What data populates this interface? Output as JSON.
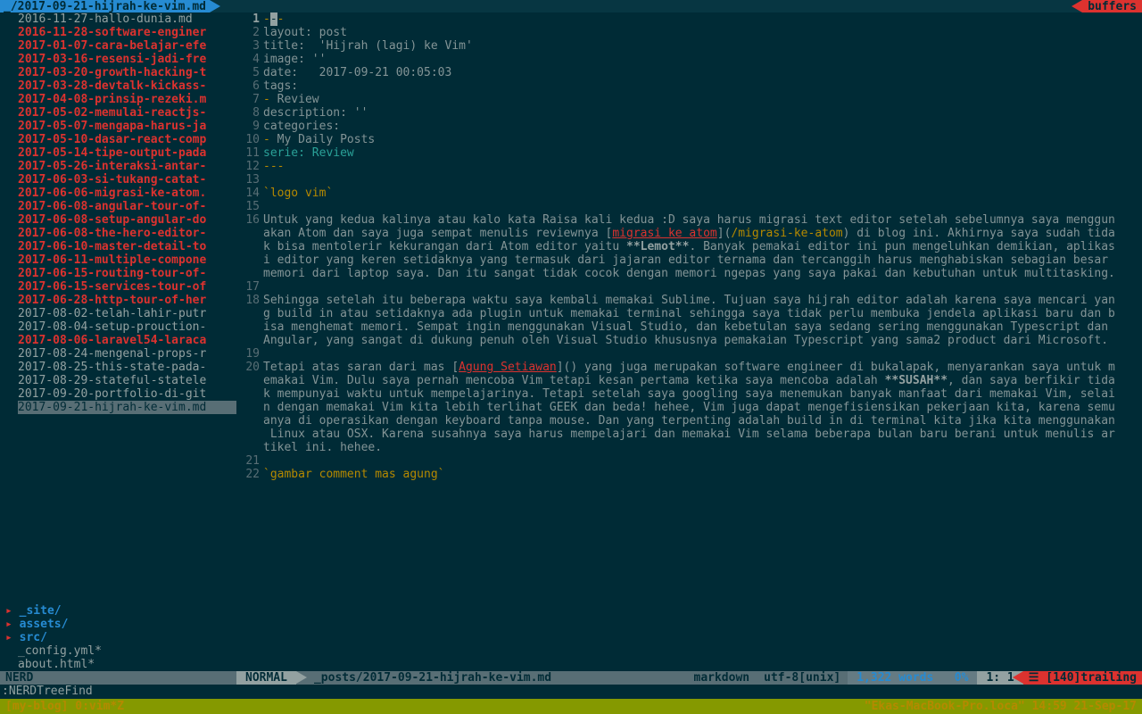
{
  "titlebar": {
    "current": "_/2017-09-21-hijrah-ke-vim.md",
    "right": "buffers"
  },
  "files": [
    {
      "name": "2016-11-27-hallo-dunia.md",
      "mod": false
    },
    {
      "name": "2016-11-28-software-enginer",
      "mod": true
    },
    {
      "name": "2017-01-07-cara-belajar-efe",
      "mod": true
    },
    {
      "name": "2017-03-16-resensi-jadi-fre",
      "mod": true
    },
    {
      "name": "2017-03-20-growth-hacking-t",
      "mod": true
    },
    {
      "name": "2017-03-28-devtalk-kickass-",
      "mod": true
    },
    {
      "name": "2017-04-08-prinsip-rezeki.m",
      "mod": true
    },
    {
      "name": "2017-05-02-memulai-reactjs-",
      "mod": true
    },
    {
      "name": "2017-05-07-mengapa-harus-ja",
      "mod": true
    },
    {
      "name": "2017-05-10-dasar-react-comp",
      "mod": true
    },
    {
      "name": "2017-05-14-tipe-output-pada",
      "mod": true
    },
    {
      "name": "2017-05-26-interaksi-antar-",
      "mod": true
    },
    {
      "name": "2017-06-03-si-tukang-catat-",
      "mod": true
    },
    {
      "name": "2017-06-06-migrasi-ke-atom.",
      "mod": true
    },
    {
      "name": "2017-06-08-angular-tour-of-",
      "mod": true
    },
    {
      "name": "2017-06-08-setup-angular-do",
      "mod": true
    },
    {
      "name": "2017-06-08-the-hero-editor-",
      "mod": true
    },
    {
      "name": "2017-06-10-master-detail-to",
      "mod": true
    },
    {
      "name": "2017-06-11-multiple-compone",
      "mod": true
    },
    {
      "name": "2017-06-15-routing-tour-of-",
      "mod": true
    },
    {
      "name": "2017-06-15-services-tour-of",
      "mod": true
    },
    {
      "name": "2017-06-28-http-tour-of-her",
      "mod": true
    },
    {
      "name": "2017-08-02-telah-lahir-putr",
      "mod": false
    },
    {
      "name": "2017-08-04-setup-prouction-",
      "mod": false
    },
    {
      "name": "2017-08-06-laravel54-laraca",
      "mod": true
    },
    {
      "name": "2017-08-24-mengenal-props-r",
      "mod": false
    },
    {
      "name": "2017-08-25-this-state-pada-",
      "mod": false
    },
    {
      "name": "2017-08-29-stateful-statele",
      "mod": false
    },
    {
      "name": "2017-09-20-portfolio-di-git",
      "mod": false
    },
    {
      "name": "2017-09-21-hijrah-ke-vim.md",
      "mod": false,
      "active": true
    }
  ],
  "dirs": [
    "_site/",
    "assets/",
    "src/"
  ],
  "plain_rows": [
    "_config.yml*",
    "about.html*"
  ],
  "editor_lines": [
    {
      "n": 1,
      "cur": true,
      "seg": [
        {
          "t": "fm",
          "v": "-"
        },
        {
          "t": "cursor",
          "v": "-"
        },
        {
          "t": "fm",
          "v": "-"
        }
      ]
    },
    {
      "n": 2,
      "seg": [
        {
          "t": "kw",
          "v": "layout: post"
        }
      ]
    },
    {
      "n": 3,
      "seg": [
        {
          "t": "kw",
          "v": "title:  'Hijrah (lagi) ke Vim'"
        }
      ]
    },
    {
      "n": 4,
      "seg": [
        {
          "t": "kw",
          "v": "image: ''"
        }
      ]
    },
    {
      "n": 5,
      "seg": [
        {
          "t": "kw",
          "v": "date:   2017-09-21 00:05:03"
        }
      ]
    },
    {
      "n": 6,
      "seg": [
        {
          "t": "kw",
          "v": "tags:"
        }
      ]
    },
    {
      "n": 7,
      "seg": [
        {
          "t": "fm",
          "v": "- "
        },
        {
          "t": "kw",
          "v": "Review"
        }
      ]
    },
    {
      "n": 8,
      "seg": [
        {
          "t": "kw",
          "v": "description: ''"
        }
      ]
    },
    {
      "n": 9,
      "seg": [
        {
          "t": "kw",
          "v": "categories:"
        }
      ]
    },
    {
      "n": 10,
      "seg": [
        {
          "t": "fm",
          "v": "- "
        },
        {
          "t": "kw",
          "v": "My Daily Posts"
        }
      ]
    },
    {
      "n": 11,
      "seg": [
        {
          "t": "cyan",
          "v": "serie: Review"
        }
      ]
    },
    {
      "n": 12,
      "seg": [
        {
          "t": "fm",
          "v": "---"
        }
      ]
    },
    {
      "n": 13,
      "seg": [
        {
          "t": "kw",
          "v": ""
        }
      ]
    },
    {
      "n": 14,
      "seg": [
        {
          "t": "fm",
          "v": "`logo vim`"
        }
      ]
    },
    {
      "n": 15,
      "seg": [
        {
          "t": "kw",
          "v": ""
        }
      ]
    },
    {
      "n": 16,
      "seg": [
        {
          "t": "kw",
          "v": "Untuk yang kedua kalinya atau kalo kata Raisa kali kedua :D saya harus migrasi text editor setelah sebelumnya saya menggun"
        }
      ]
    },
    {
      "seg": [
        {
          "t": "kw",
          "v": "akan Atom dan saya juga sempat menulis reviewnya ["
        },
        {
          "t": "link",
          "v": "migrasi ke atom"
        },
        {
          "t": "kw",
          "v": "]("
        },
        {
          "t": "url",
          "v": "/migrasi-ke-atom"
        },
        {
          "t": "kw",
          "v": ") di blog ini. Akhirnya saya sudah tida"
        }
      ]
    },
    {
      "seg": [
        {
          "t": "kw",
          "v": "k bisa mentolerir kekurangan dari Atom editor yaitu "
        },
        {
          "t": "bold",
          "v": "**Lemot**"
        },
        {
          "t": "kw",
          "v": ". Banyak pemakai editor ini pun mengeluhkan demikian, aplikas"
        }
      ]
    },
    {
      "seg": [
        {
          "t": "kw",
          "v": "i editor yang keren setidaknya yang termasuk dari jajaran editor ternama dan tercanggih harus menghabiskan sebagian besar"
        }
      ]
    },
    {
      "seg": [
        {
          "t": "kw",
          "v": "memori dari laptop saya. Dan itu sangat tidak cocok dengan memori ngepas yang saya pakai dan kebutuhan untuk multitasking."
        }
      ]
    },
    {
      "n": 17,
      "seg": [
        {
          "t": "kw",
          "v": ""
        }
      ]
    },
    {
      "n": 18,
      "seg": [
        {
          "t": "kw",
          "v": "Sehingga setelah itu beberapa waktu saya kembali memakai Sublime. Tujuan saya hijrah editor adalah karena saya mencari yan"
        }
      ]
    },
    {
      "seg": [
        {
          "t": "kw",
          "v": "g build in atau setidaknya ada plugin untuk memakai terminal sehingga saya tidak perlu membuka jendela aplikasi baru dan b"
        }
      ]
    },
    {
      "seg": [
        {
          "t": "kw",
          "v": "isa menghemat memori. Sempat ingin menggunakan Visual Studio, dan kebetulan saya sedang sering menggunakan Typescript dan "
        }
      ]
    },
    {
      "seg": [
        {
          "t": "kw",
          "v": "Angular, yang sangat di dukung penuh oleh Visual Studio khususnya pemakaian Typescript yang sama2 product dari Microsoft."
        }
      ]
    },
    {
      "n": 19,
      "seg": [
        {
          "t": "kw",
          "v": ""
        }
      ]
    },
    {
      "n": 20,
      "seg": [
        {
          "t": "kw",
          "v": "Tetapi atas saran dari mas ["
        },
        {
          "t": "link",
          "v": "Agung Setiawan"
        },
        {
          "t": "kw",
          "v": "]() yang juga merupakan software engineer di bukalapak, menyarankan saya untuk m"
        }
      ]
    },
    {
      "seg": [
        {
          "t": "kw",
          "v": "emakai Vim. Dulu saya pernah mencoba Vim tetapi kesan pertama ketika saya mencoba adalah "
        },
        {
          "t": "bold",
          "v": "**SUSAH**"
        },
        {
          "t": "kw",
          "v": ", dan saya berfikir tida"
        }
      ]
    },
    {
      "seg": [
        {
          "t": "kw",
          "v": "k mempunyai waktu untuk mempelajarinya. Tetapi setelah saya googling saya menemukan banyak manfaat dari memakai Vim, selai"
        }
      ]
    },
    {
      "seg": [
        {
          "t": "kw",
          "v": "n dengan memakai Vim kita lebih terlihat GEEK dan beda! hehee, Vim juga dapat mengefisiensikan pekerjaan kita, karena semu"
        }
      ]
    },
    {
      "seg": [
        {
          "t": "kw",
          "v": "anya di operasikan dengan keyboard tanpa mouse. Dan yang terpenting adalah build in di terminal kita jika kita menggunakan"
        }
      ]
    },
    {
      "seg": [
        {
          "t": "kw",
          "v": " Linux atau OSX. Karena susahnya saya harus mempelajari dan memakai Vim selama beberapa bulan baru berani untuk menulis ar"
        }
      ]
    },
    {
      "seg": [
        {
          "t": "kw",
          "v": "tikel ini. hehee."
        }
      ]
    },
    {
      "n": 21,
      "seg": [
        {
          "t": "kw",
          "v": ""
        }
      ]
    },
    {
      "n": 22,
      "seg": [
        {
          "t": "fm",
          "v": "`gambar comment mas agung`"
        }
      ]
    }
  ],
  "status": {
    "nerd_label": "NERD",
    "mode": "NORMAL",
    "path": "_posts/2017-09-21-hijrah-ke-vim.md",
    "filetype": "markdown",
    "encoding": "utf-8[unix]",
    "stats": "1,322 words",
    "percent": "0%",
    "pos": "1:  1",
    "trailing": "☰ [140]trailing"
  },
  "cmdline": ":NERDTreeFind",
  "tmux": {
    "left": "[my-blog] 0:vim*Z",
    "right": "\"Ekas-MacBook-Pro.loca\" 14:59 21-Sep-17"
  }
}
